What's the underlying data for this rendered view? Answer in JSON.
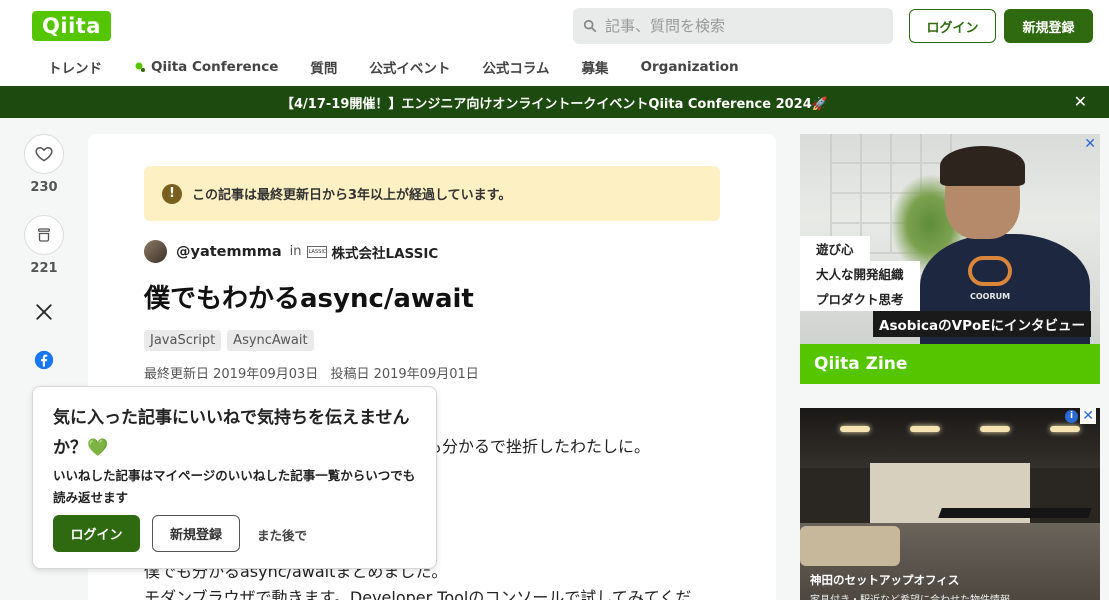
{
  "header": {
    "logo": "Qiita",
    "search_placeholder": "記事、質問を検索",
    "login_label": "ログイン",
    "signup_label": "新規登録",
    "nav": [
      {
        "label": "トレンド"
      },
      {
        "label": "Qiita Conference"
      },
      {
        "label": "質問"
      },
      {
        "label": "公式イベント"
      },
      {
        "label": "公式コラム"
      },
      {
        "label": "募集"
      },
      {
        "label": "Organization"
      }
    ]
  },
  "banner": {
    "text": "【4/17-19開催！】エンジニア向けオンライントークイベントQiita Conference 2024🚀",
    "close": "✕"
  },
  "sidebar": {
    "like_count": "230",
    "stock_count": "221"
  },
  "article": {
    "notice": "この記事は最終更新日から3年以上が経過しています。",
    "notice_icon": "!",
    "author": "@yatemmma",
    "in_label": "in",
    "org_logo_text": "LASSIC",
    "organization": "株式会社LASSIC",
    "title": "僕でもわかるasync/await",
    "tags": [
      "JavaScript",
      "AsyncAwait"
    ],
    "updated": "最終更新日 2019年09月03日",
    "posted": "投稿日 2019年09月01日",
    "body_line1": "も分かるで挫折したわたしに。",
    "body_line2": "僕でも分かるasync/awaitまとめました。",
    "body_line3": "モダンブラウザで動きます。Developer Toolのコンソールで試してみてくだ"
  },
  "popup": {
    "title": "気に入った記事にいいねで気持ちを伝えませんか？💚",
    "description": "いいねした記事はマイページのいいねした記事一覧からいつでも読み返せます",
    "login_label": "ログイン",
    "signup_label": "新規登録",
    "later_label": "また後で"
  },
  "ads": {
    "ad1": {
      "labels": [
        "遊び心",
        "大人な開発組織",
        "プロダクト思考"
      ],
      "highlight": "AsobicaのVPoEにインタビュー",
      "footer": "Qiita Zine",
      "shirt_text": "COORUM"
    },
    "ad2": {
      "title": "神田のセットアップオフィス",
      "subtitle": "家具付き・駅近など希望に合わせた物件情報",
      "info": "i",
      "close": "✕"
    }
  },
  "colors": {
    "brand": "#55c500",
    "primary_button": "#2f6a10",
    "banner": "#1d4a0e",
    "notice_bg": "#fdf1c4"
  }
}
